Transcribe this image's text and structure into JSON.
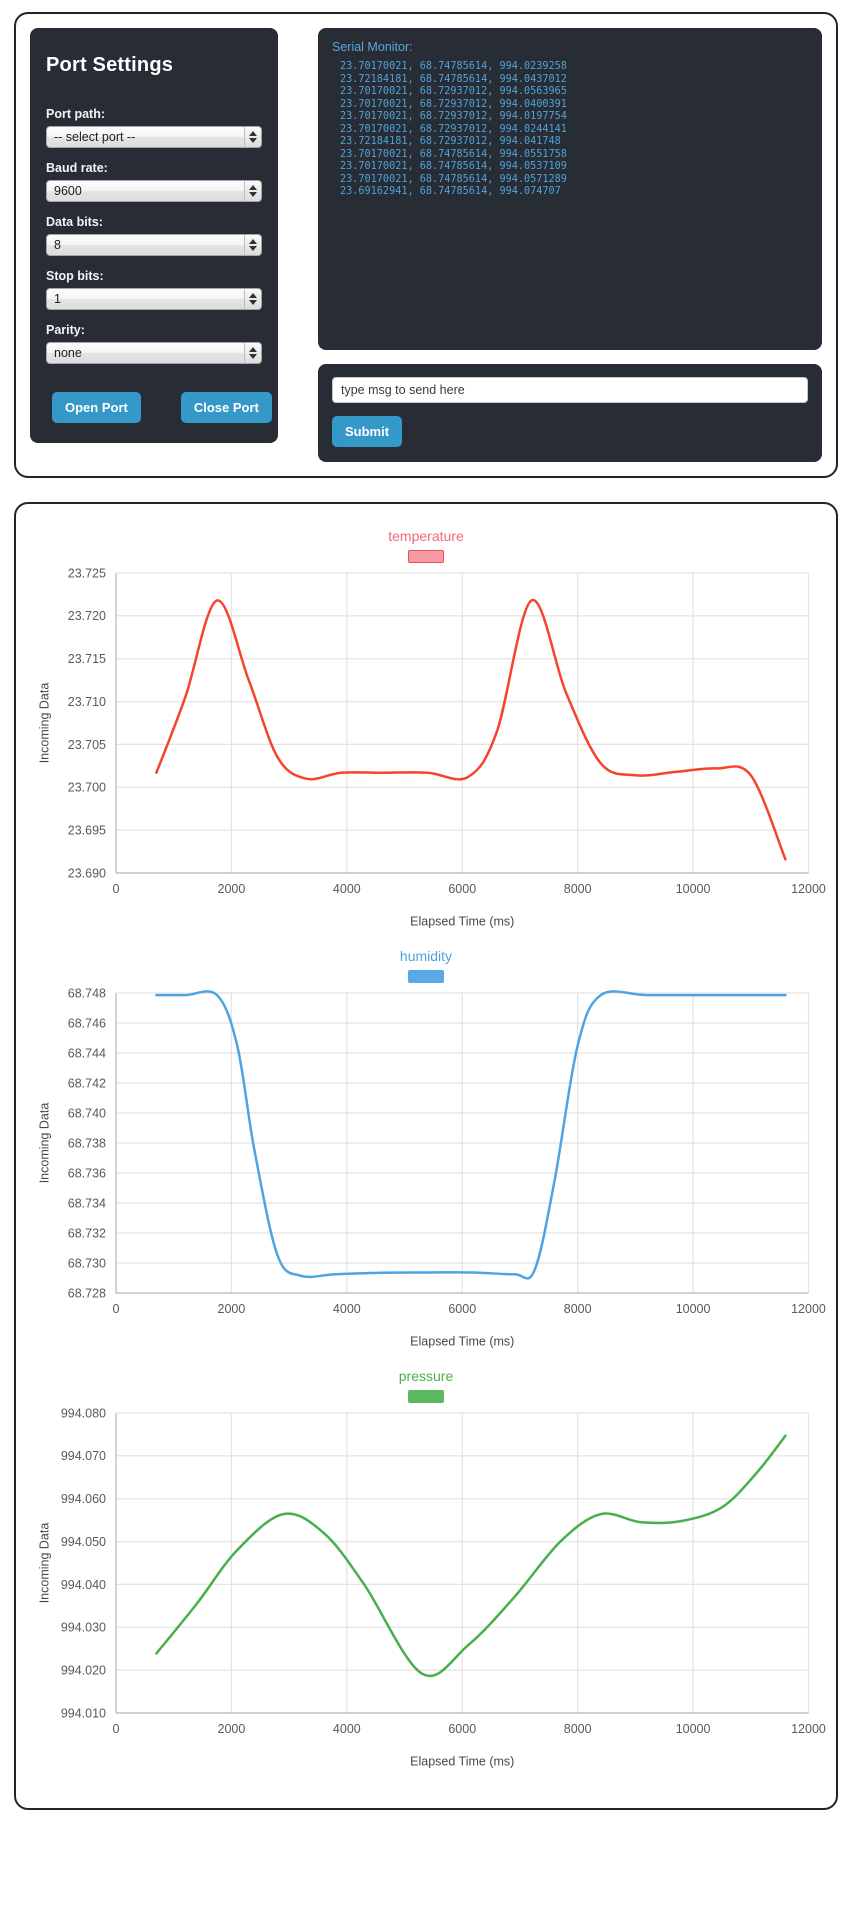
{
  "port_settings": {
    "title": "Port Settings",
    "fields": [
      {
        "label": "Port path:",
        "value": "-- select port --",
        "name": "port-path"
      },
      {
        "label": "Baud rate:",
        "value": "9600",
        "name": "baud-rate"
      },
      {
        "label": "Data bits:",
        "value": "8",
        "name": "data-bits"
      },
      {
        "label": "Stop bits:",
        "value": "1",
        "name": "stop-bits"
      },
      {
        "label": "Parity:",
        "value": "none",
        "name": "parity"
      }
    ],
    "open_button": "Open Port",
    "close_button": "Close Port",
    "accent_color": "#3498c8",
    "panel_color": "#282c34"
  },
  "serial_monitor": {
    "title": "Serial Monitor:",
    "text_color": "#4fa3d9",
    "lines": [
      "23.70170021, 68.74785614, 994.0239258",
      "23.72184181, 68.74785614, 994.0437012",
      "23.70170021, 68.72937012, 994.0563965",
      "23.70170021, 68.72937012, 994.0400391",
      "23.70170021, 68.72937012, 994.0197754",
      "23.70170021, 68.72937012, 994.0244141",
      "23.72184181, 68.72937012, 994.041748",
      "23.70170021, 68.74785614, 994.0551758",
      "23.70170021, 68.74785614, 994.0537109",
      "23.70170021, 68.74785614, 994.0571289",
      "23.69162941, 68.74785614, 994.074707"
    ]
  },
  "send_form": {
    "input_placeholder": "type msg to send here",
    "input_value": "",
    "submit_label": "Submit"
  },
  "chart_data": [
    {
      "type": "line",
      "title": "temperature",
      "color": "#f4442e",
      "legend_color": "#f79ba3",
      "xlabel": "Elapsed Time (ms)",
      "ylabel": "Incoming Data",
      "xticks": [
        0,
        2000,
        4000,
        6000,
        8000,
        10000,
        12000
      ],
      "yticks": [
        23.69,
        23.695,
        23.7,
        23.705,
        23.71,
        23.715,
        23.72,
        23.725
      ],
      "ytick_labels": [
        "23.690",
        "23.695",
        "23.700",
        "23.705",
        "23.710",
        "23.715",
        "23.720",
        "23.725"
      ],
      "xlim": [
        0,
        12000
      ],
      "ylim": [
        23.69,
        23.725
      ],
      "grid": true,
      "legend_position": "top-center",
      "x": [
        700,
        1200,
        1750,
        2300,
        2800,
        3300,
        3900,
        4600,
        5400,
        6100,
        6600,
        7200,
        7800,
        8400,
        9000,
        9700,
        10400,
        11000,
        11600
      ],
      "values": [
        23.7017,
        23.7105,
        23.7218,
        23.7125,
        23.7035,
        23.701,
        23.7017,
        23.7017,
        23.7017,
        23.7012,
        23.7065,
        23.7218,
        23.711,
        23.7028,
        23.7014,
        23.7018,
        23.7022,
        23.7014,
        23.6916
      ]
    },
    {
      "type": "line",
      "title": "humidity",
      "color": "#4fa3e0",
      "legend_color": "#5aa8e6",
      "xlabel": "Elapsed Time (ms)",
      "ylabel": "Incoming Data",
      "xticks": [
        0,
        2000,
        4000,
        6000,
        8000,
        10000,
        12000
      ],
      "yticks": [
        68.728,
        68.73,
        68.732,
        68.734,
        68.736,
        68.738,
        68.74,
        68.742,
        68.744,
        68.746,
        68.748
      ],
      "ytick_labels": [
        "68.728",
        "68.730",
        "68.732",
        "68.734",
        "68.736",
        "68.738",
        "68.740",
        "68.742",
        "68.744",
        "68.746",
        "68.748"
      ],
      "xlim": [
        0,
        12000
      ],
      "ylim": [
        68.728,
        68.748
      ],
      "grid": true,
      "legend_position": "top-center",
      "x": [
        700,
        1200,
        1750,
        2100,
        2400,
        2800,
        3200,
        3800,
        4600,
        5400,
        6200,
        6900,
        7250,
        7600,
        8000,
        8400,
        9200,
        10200,
        11000,
        11600
      ],
      "values": [
        68.74786,
        68.74786,
        68.74786,
        68.7445,
        68.7375,
        68.7305,
        68.72915,
        68.72925,
        68.72935,
        68.72937,
        68.72937,
        68.72925,
        68.7295,
        68.7355,
        68.7445,
        68.74786,
        68.74786,
        68.74786,
        68.74786,
        68.74786
      ]
    },
    {
      "type": "line",
      "title": "pressure",
      "color": "#47b04b",
      "legend_color": "#5ab95e",
      "xlabel": "Elapsed Time (ms)",
      "ylabel": "Incoming Data",
      "xticks": [
        0,
        2000,
        4000,
        6000,
        8000,
        10000,
        12000
      ],
      "yticks": [
        994.01,
        994.02,
        994.03,
        994.04,
        994.05,
        994.06,
        994.07,
        994.08
      ],
      "ytick_labels": [
        "994.010",
        "994.020",
        "994.030",
        "994.040",
        "994.050",
        "994.060",
        "994.070",
        "994.080"
      ],
      "xlim": [
        0,
        12000
      ],
      "ylim": [
        994.01,
        994.08
      ],
      "grid": true,
      "legend_position": "top-center",
      "x": [
        700,
        1400,
        2100,
        2900,
        3600,
        4300,
        5300,
        6100,
        6900,
        7700,
        8400,
        9100,
        9800,
        10500,
        11100,
        11600
      ],
      "values": [
        994.0239,
        994.0355,
        994.048,
        994.0564,
        994.052,
        994.04,
        994.0192,
        994.0258,
        994.037,
        994.05,
        994.0564,
        994.0545,
        994.0548,
        994.058,
        994.066,
        994.0747
      ]
    }
  ]
}
